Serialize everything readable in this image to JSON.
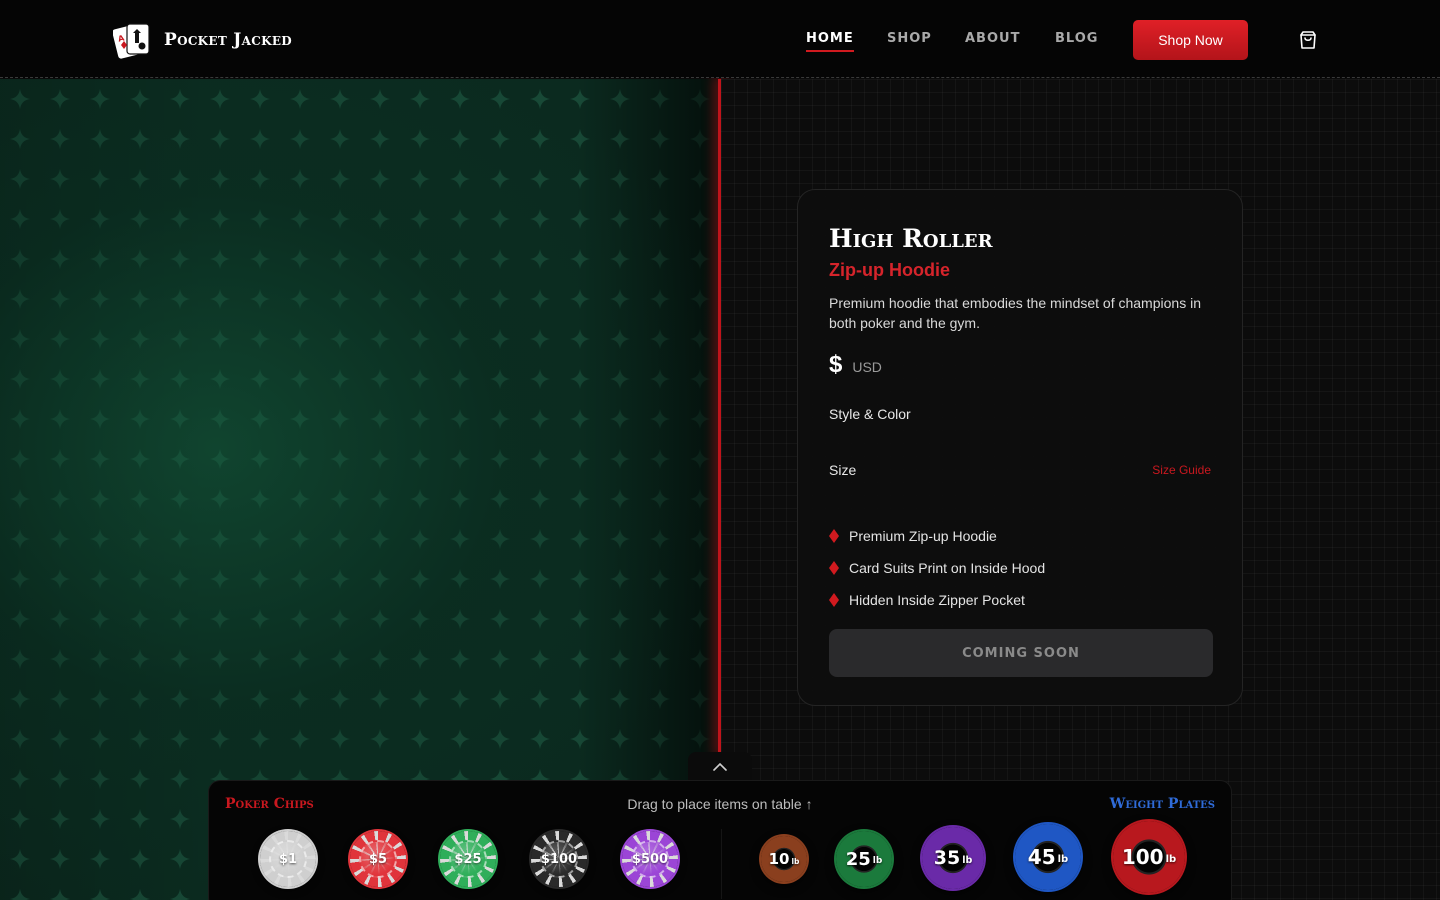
{
  "header": {
    "brand": "Pocket Jacked",
    "nav": [
      {
        "label": "HOME",
        "active": true
      },
      {
        "label": "SHOP",
        "active": false
      },
      {
        "label": "ABOUT",
        "active": false
      },
      {
        "label": "BLOG",
        "active": false
      }
    ],
    "cta_label": "Shop Now",
    "cart_icon": "shopping-bag-icon"
  },
  "product": {
    "title": "High Roller",
    "subtitle": "Zip-up Hoodie",
    "description": "Premium hoodie that embodies the mindset of champions in both poker and the gym.",
    "price_symbol": "$",
    "currency": "USD",
    "style_label": "Style & Color",
    "size_label": "Size",
    "size_guide_label": "Size Guide",
    "features": [
      "Premium Zip-up Hoodie",
      "Card Suits Print on Inside Hood",
      "Hidden Inside Zipper Pocket"
    ],
    "button_label": "COMING SOON"
  },
  "tray": {
    "chips_heading": "Poker Chips",
    "hint": "Drag to place items on table ↑",
    "plates_heading": "Weight Plates",
    "chips": [
      {
        "label": "$1",
        "color": "#cfcfcf"
      },
      {
        "label": "$5",
        "color": "#e0343b"
      },
      {
        "label": "$25",
        "color": "#2fae5a"
      },
      {
        "label": "$100",
        "color": "#2a2a2a"
      },
      {
        "label": "$500",
        "color": "#9b45d6"
      }
    ],
    "plates": [
      {
        "value": "10",
        "unit": "lb",
        "color": "#8a3f1e"
      },
      {
        "value": "25",
        "unit": "lb",
        "color": "#1b7a3c"
      },
      {
        "value": "35",
        "unit": "lb",
        "color": "#6a2aa8"
      },
      {
        "value": "45",
        "unit": "lb",
        "color": "#1f57c4"
      },
      {
        "value": "100",
        "unit": "lb",
        "color": "#b8181e"
      }
    ]
  },
  "colors": {
    "accent_red": "#d11a1f",
    "felt_green": "#0b2a1f",
    "plates_blue": "#2f6bd8"
  }
}
